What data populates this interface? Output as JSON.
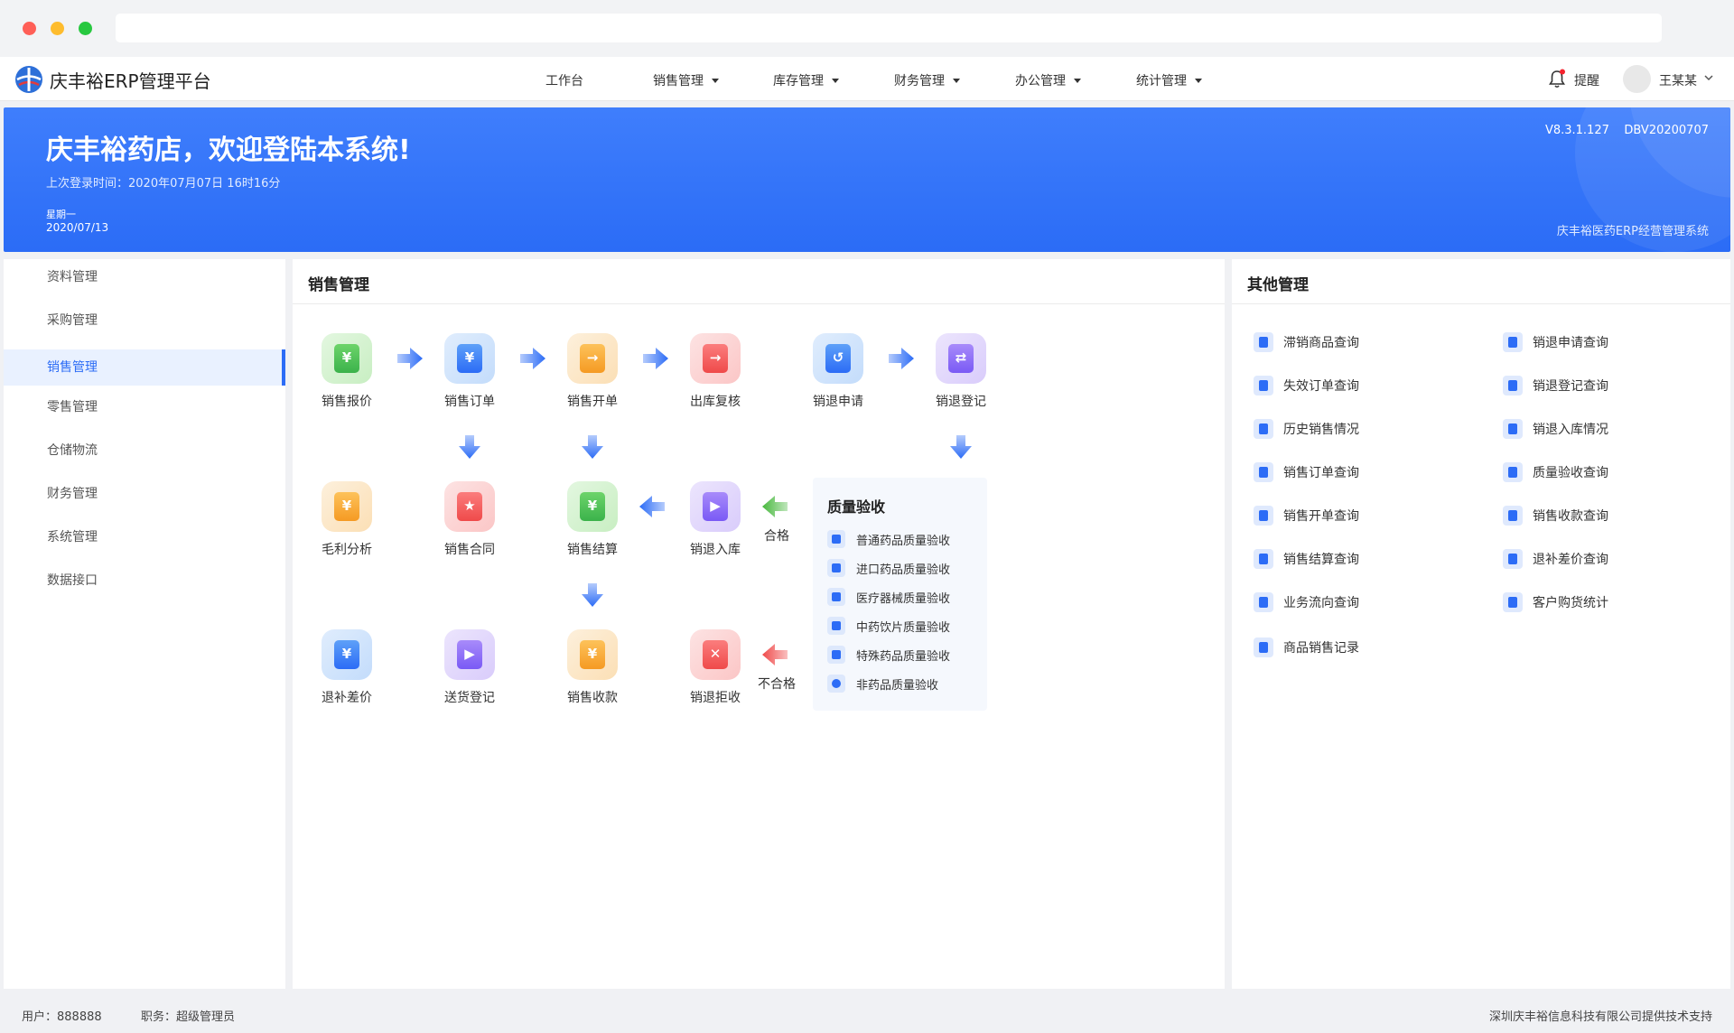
{
  "window": {
    "dot_colors": [
      "#ff5f57",
      "#febc2e",
      "#28c840"
    ]
  },
  "header": {
    "brand": "庆丰裕ERP管理平台",
    "nav": [
      {
        "label": "工作台",
        "has_caret": false
      },
      {
        "label": "销售管理",
        "has_caret": true
      },
      {
        "label": "库存管理",
        "has_caret": true
      },
      {
        "label": "财务管理",
        "has_caret": true
      },
      {
        "label": "办公管理",
        "has_caret": true
      },
      {
        "label": "统计管理",
        "has_caret": true
      }
    ],
    "remind_label": "提醒",
    "user_name": "王某某"
  },
  "banner": {
    "title": "庆丰裕药店，欢迎登陆本系统!",
    "last_login": "上次登录时间：2020年07月07日 16时16分",
    "weekday": "星期一",
    "date": "2020/07/13",
    "version": "V8.3.1.127    DBV20200707",
    "system_name": "庆丰裕医药ERP经营管理系统"
  },
  "sidebar": {
    "items": [
      "资料管理",
      "采购管理",
      "销售管理",
      "零售管理",
      "仓储物流",
      "财务管理",
      "系统管理",
      "数据接口"
    ],
    "active_index": 2
  },
  "sales": {
    "title": "销售管理",
    "flow": [
      {
        "label": "销售报价",
        "color": "green",
        "sym": "¥"
      },
      {
        "label": "销售订单",
        "color": "blue",
        "sym": "¥"
      },
      {
        "label": "销售开单",
        "color": "orange",
        "sym": "→"
      },
      {
        "label": "出库复核",
        "color": "red",
        "sym": "→"
      },
      {
        "label": "销退申请",
        "color": "blue",
        "sym": "↺"
      },
      {
        "label": "销退登记",
        "color": "purple",
        "sym": "⇄"
      },
      {
        "label": "毛利分析",
        "color": "orange",
        "sym": "¥"
      },
      {
        "label": "销售合同",
        "color": "red",
        "sym": "★"
      },
      {
        "label": "销售结算",
        "color": "green",
        "sym": "¥"
      },
      {
        "label": "销退入库",
        "color": "purple",
        "sym": "▶"
      },
      {
        "label": "退补差价",
        "color": "blue",
        "sym": "¥"
      },
      {
        "label": "送货登记",
        "color": "purple",
        "sym": "▶"
      },
      {
        "label": "销售收款",
        "color": "orange",
        "sym": "¥"
      },
      {
        "label": "销退拒收",
        "color": "red",
        "sym": "✕"
      }
    ],
    "pass_label": "合格",
    "fail_label": "不合格",
    "quality": {
      "title": "质量验收",
      "items": [
        "普通药品质量验收",
        "进口药品质量验收",
        "医疗器械质量验收",
        "中药饮片质量验收",
        "特殊药品质量验收",
        "非药品质量验收"
      ]
    }
  },
  "other": {
    "title": "其他管理",
    "col1": [
      "滞销商品查询",
      "失效订单查询",
      "历史销售情况",
      "销售订单查询",
      "销售开单查询",
      "销售结算查询",
      "业务流向查询",
      "商品销售记录"
    ],
    "col2": [
      "销退申请查询",
      "销退登记查询",
      "销退入库情况",
      "质量验收查询",
      "销售收款查询",
      "退补差价查询",
      "客户购货统计"
    ]
  },
  "footer": {
    "user": "用户：888888",
    "role": "职务：超级管理员",
    "support": "深圳庆丰裕信息科技有限公司提供技术支持"
  }
}
